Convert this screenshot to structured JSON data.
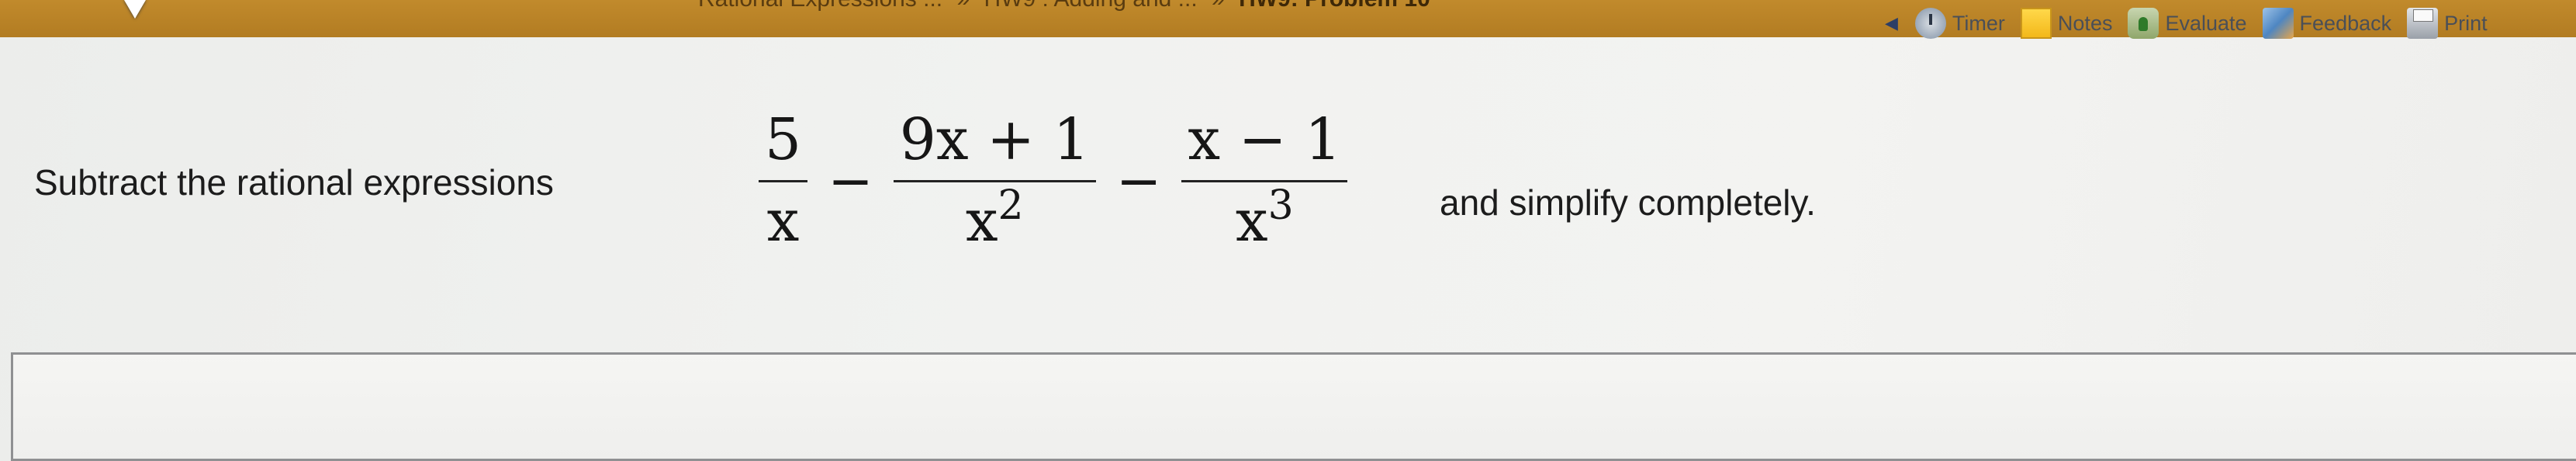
{
  "header": {
    "breadcrumb_items": [
      "Rational Expressions ...",
      "HW9 : Adding and ..."
    ],
    "breadcrumb_separator": "»",
    "problem_title": "HW9: Problem 10"
  },
  "toolbar": {
    "collapse_arrow": "◀",
    "items": [
      {
        "label": "Timer",
        "icon": "timer-icon"
      },
      {
        "label": "Notes",
        "icon": "notes-icon"
      },
      {
        "label": "Evaluate",
        "icon": "evaluate-icon"
      },
      {
        "label": "Feedback",
        "icon": "feedback-icon"
      },
      {
        "label": "Print",
        "icon": "print-icon"
      }
    ]
  },
  "problem": {
    "prompt": "Subtract the rational expressions",
    "suffix": "and simplify completely.",
    "expression": {
      "fractions": [
        {
          "numerator": "5",
          "denominator": "x",
          "denominator_exponent": ""
        },
        {
          "numerator": "9x + 1",
          "denominator": "x",
          "denominator_exponent": "2"
        },
        {
          "numerator": "x − 1",
          "denominator": "x",
          "denominator_exponent": "3"
        }
      ],
      "operators": [
        "−",
        "−"
      ]
    }
  },
  "answer": {
    "value": ""
  },
  "colors": {
    "header_bar": "#b27c22",
    "page_background": "#f1f2f0",
    "answer_border": "#8f9092"
  }
}
